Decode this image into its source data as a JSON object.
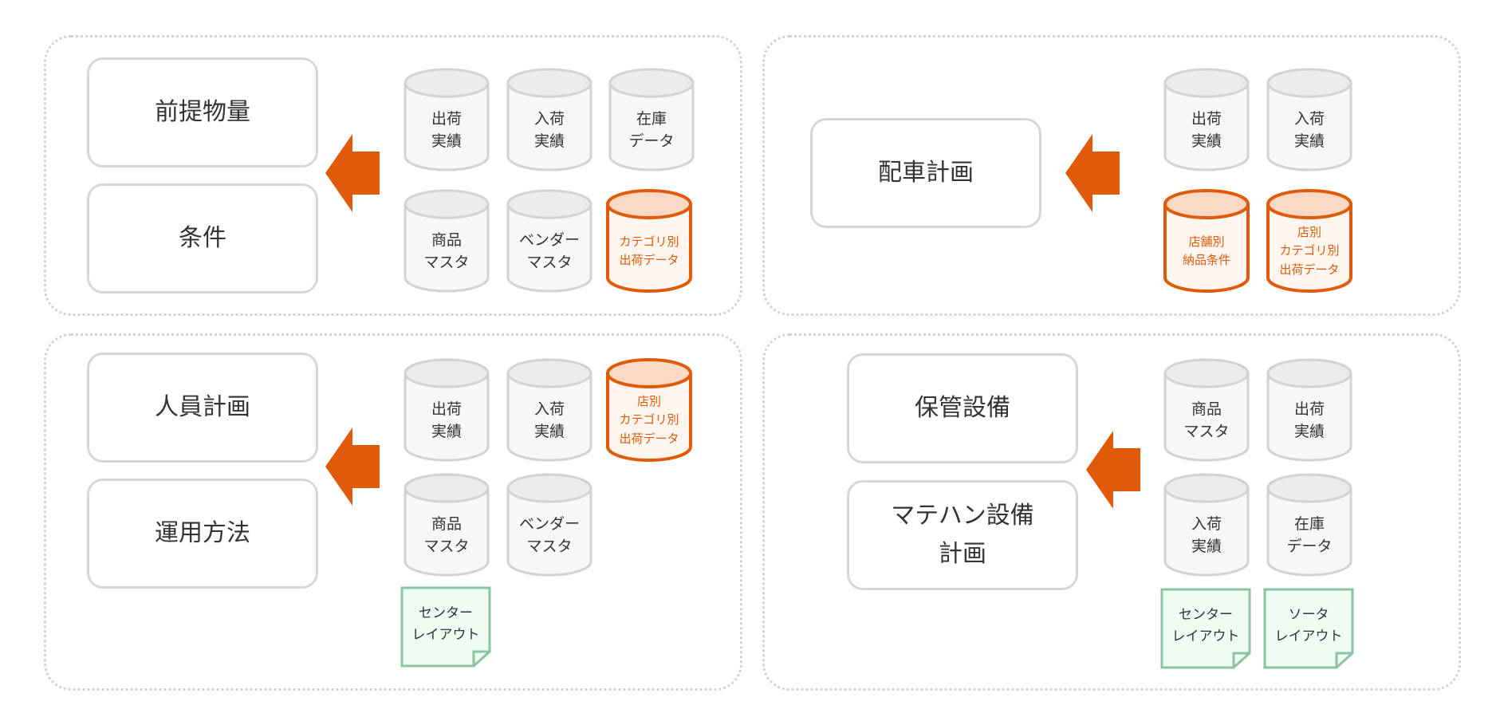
{
  "colors": {
    "accent": "#e05a0a",
    "gray_stroke": "#d2d2d2",
    "orange_fill": "#fff6f0",
    "orange_top": "#fcd9c4",
    "doc_stroke": "#8cc4a0",
    "doc_fill": "#effcf3"
  },
  "panels": [
    {
      "outputs": [
        "前提物量",
        "条件"
      ],
      "sources": [
        {
          "label": "出荷\n実績",
          "type": "gray",
          "icon": "database-icon"
        },
        {
          "label": "入荷\n実績",
          "type": "gray",
          "icon": "database-icon"
        },
        {
          "label": "在庫\nデータ",
          "type": "gray",
          "icon": "database-icon"
        },
        {
          "label": "商品\nマスタ",
          "type": "gray",
          "icon": "database-icon"
        },
        {
          "label": "ベンダー\nマスタ",
          "type": "gray",
          "icon": "database-icon"
        },
        {
          "label": "カテゴリ別\n出荷データ",
          "type": "orange",
          "icon": "database-icon"
        }
      ]
    },
    {
      "outputs": [
        "配車計画"
      ],
      "sources": [
        {
          "label": "出荷\n実績",
          "type": "gray",
          "icon": "database-icon"
        },
        {
          "label": "入荷\n実績",
          "type": "gray",
          "icon": "database-icon"
        },
        {
          "label": "店舗別\n納品条件",
          "type": "orange",
          "icon": "database-icon"
        },
        {
          "label": "店別\nカテゴリ別\n出荷データ",
          "type": "orange",
          "icon": "database-icon"
        }
      ]
    },
    {
      "outputs": [
        "人員計画",
        "運用方法"
      ],
      "sources": [
        {
          "label": "出荷\n実績",
          "type": "gray",
          "icon": "database-icon"
        },
        {
          "label": "入荷\n実績",
          "type": "gray",
          "icon": "database-icon"
        },
        {
          "label": "店別\nカテゴリ別\n出荷データ",
          "type": "orange",
          "icon": "database-icon"
        },
        {
          "label": "商品\nマスタ",
          "type": "gray",
          "icon": "database-icon"
        },
        {
          "label": "ベンダー\nマスタ",
          "type": "gray",
          "icon": "database-icon"
        },
        {
          "label": "センター\nレイアウト",
          "type": "doc",
          "icon": "document-icon"
        }
      ]
    },
    {
      "outputs": [
        "保管設備",
        "マテハン設備\n計画"
      ],
      "sources": [
        {
          "label": "商品\nマスタ",
          "type": "gray",
          "icon": "database-icon"
        },
        {
          "label": "出荷\n実績",
          "type": "gray",
          "icon": "database-icon"
        },
        {
          "label": "入荷\n実績",
          "type": "gray",
          "icon": "database-icon"
        },
        {
          "label": "在庫\nデータ",
          "type": "gray",
          "icon": "database-icon"
        },
        {
          "label": "センター\nレイアウト",
          "type": "doc",
          "icon": "document-icon"
        },
        {
          "label": "ソータ\nレイアウト",
          "type": "doc",
          "icon": "document-icon"
        }
      ]
    }
  ]
}
